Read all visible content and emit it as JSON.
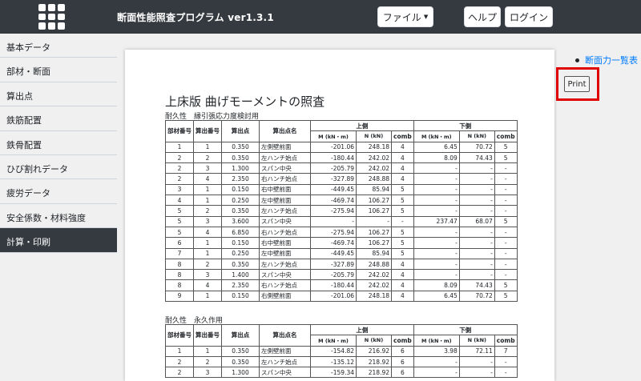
{
  "header": {
    "title": "断面性能照査プログラム ver1.3.1",
    "file_label": "ファイル",
    "help_label": "ヘルプ",
    "login_label": "ログイン"
  },
  "sidebar": {
    "items": [
      {
        "label": "基本データ",
        "active": false
      },
      {
        "label": "部材・断面",
        "active": false
      },
      {
        "label": "算出点",
        "active": false
      },
      {
        "label": "鉄筋配置",
        "active": false
      },
      {
        "label": "鉄骨配置",
        "active": false
      },
      {
        "label": "ひび割れデータ",
        "active": false
      },
      {
        "label": "疲労データ",
        "active": false
      },
      {
        "label": "安全係数・材料強度",
        "active": false
      },
      {
        "label": "計算・印刷",
        "active": true
      }
    ]
  },
  "right": {
    "link_label": "断面力一覧表",
    "print_label": "Print"
  },
  "report": {
    "title": "上床版 曲げモーメントの照査",
    "headers": {
      "member_no": "部材番号",
      "calc_no": "算出番号",
      "calc_point": "算出点",
      "calc_name": "算出点名",
      "upper": "上側",
      "lower": "下側",
      "m_unit": "M (kN・m)",
      "n_unit": "N (kN)",
      "comb": "comb"
    },
    "sections": [
      {
        "label": "耐久性　縁引張応力度検討用",
        "rows": [
          [
            "1",
            "1",
            "0.350",
            "左側壁前面",
            "-201.06",
            "248.18",
            "4",
            "6.45",
            "70.72",
            "5"
          ],
          [
            "2",
            "2",
            "0.350",
            "左ハンチ始点",
            "-180.44",
            "242.02",
            "4",
            "8.09",
            "74.43",
            "5"
          ],
          [
            "2",
            "3",
            "1.300",
            "スパン中央",
            "-205.79",
            "242.02",
            "4",
            "-",
            "-",
            "-"
          ],
          [
            "2",
            "4",
            "2.350",
            "右ハンチ始点",
            "-327.89",
            "248.88",
            "4",
            "-",
            "-",
            "-"
          ],
          [
            "3",
            "1",
            "0.150",
            "右中壁前面",
            "-449.45",
            "85.94",
            "5",
            "-",
            "-",
            "-"
          ],
          [
            "4",
            "1",
            "0.250",
            "左中壁前面",
            "-469.74",
            "106.27",
            "5",
            "-",
            "-",
            "-"
          ],
          [
            "5",
            "2",
            "0.350",
            "左ハンチ始点",
            "-275.94",
            "106.27",
            "5",
            "-",
            "-",
            "-"
          ],
          [
            "5",
            "3",
            "3.600",
            "スパン中央",
            "-",
            "-",
            "-",
            "237.47",
            "68.07",
            "5"
          ],
          [
            "5",
            "4",
            "6.850",
            "右ハンチ始点",
            "-275.94",
            "106.27",
            "5",
            "-",
            "-",
            "-"
          ],
          [
            "6",
            "1",
            "0.150",
            "右中壁前面",
            "-469.74",
            "106.27",
            "5",
            "-",
            "-",
            "-"
          ],
          [
            "7",
            "1",
            "0.250",
            "左中壁前面",
            "-449.45",
            "85.94",
            "5",
            "-",
            "-",
            "-"
          ],
          [
            "8",
            "2",
            "0.350",
            "左ハンチ始点",
            "-327.89",
            "248.88",
            "4",
            "-",
            "-",
            "-"
          ],
          [
            "8",
            "3",
            "1.400",
            "スパン中央",
            "-205.79",
            "242.02",
            "4",
            "-",
            "-",
            "-"
          ],
          [
            "8",
            "4",
            "2.350",
            "右ハンチ始点",
            "-180.44",
            "242.02",
            "4",
            "8.09",
            "74.43",
            "5"
          ],
          [
            "9",
            "1",
            "0.150",
            "右側壁前面",
            "-201.06",
            "248.18",
            "4",
            "6.45",
            "70.72",
            "5"
          ]
        ]
      },
      {
        "label": "耐久性　永久作用",
        "rows": [
          [
            "1",
            "1",
            "0.350",
            "左側壁前面",
            "-154.82",
            "216.92",
            "6",
            "3.98",
            "72.11",
            "7"
          ],
          [
            "2",
            "2",
            "0.350",
            "左ハンチ始点",
            "-135.12",
            "218.92",
            "6",
            "-",
            "-",
            "-"
          ],
          [
            "2",
            "3",
            "1.300",
            "スパン中央",
            "-159.34",
            "218.92",
            "6",
            "-",
            "-",
            "-"
          ]
        ]
      }
    ]
  }
}
